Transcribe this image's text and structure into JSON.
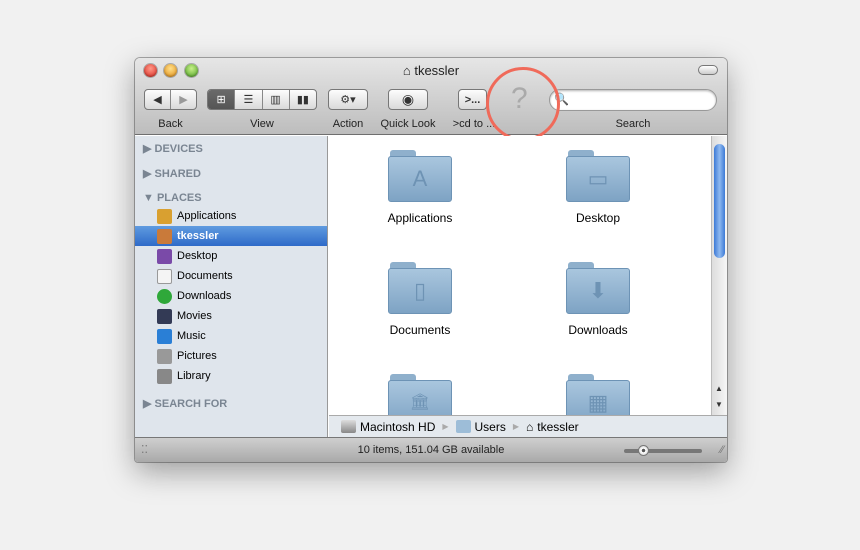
{
  "window": {
    "title": "tkessler"
  },
  "toolbar": {
    "back": "Back",
    "view": "View",
    "action": "Action",
    "quick_look": "Quick Look",
    "cd_to": ">cd to ...",
    "cd_glyph": ">...",
    "search": "Search",
    "search_placeholder": "",
    "unknown_glyph": "?"
  },
  "sidebar": {
    "devices": "DEVICES",
    "shared": "SHARED",
    "places": "PLACES",
    "search_for": "SEARCH FOR",
    "items": [
      {
        "label": "Applications",
        "color": "#d9a030"
      },
      {
        "label": "tkessler",
        "color": "#c97a3a"
      },
      {
        "label": "Desktop",
        "color": "#7a4aa8"
      },
      {
        "label": "Documents",
        "color": "#f4f4f4"
      },
      {
        "label": "Downloads",
        "color": "#2fa83a"
      },
      {
        "label": "Movies",
        "color": "#333a55"
      },
      {
        "label": "Music",
        "color": "#2a7fd6"
      },
      {
        "label": "Pictures",
        "color": "#999"
      },
      {
        "label": "Library",
        "color": "#888"
      }
    ]
  },
  "content": {
    "items": [
      {
        "label": "Applications",
        "icon": "A"
      },
      {
        "label": "Desktop",
        "icon": "▭"
      },
      {
        "label": "Documents",
        "icon": "▯"
      },
      {
        "label": "Downloads",
        "icon": "⬇"
      },
      {
        "label": "",
        "icon": "🏛"
      },
      {
        "label": "",
        "icon": "▦"
      }
    ]
  },
  "pathbar": [
    "Macintosh HD",
    "Users",
    "tkessler"
  ],
  "status": {
    "text": "10 items, 151.04 GB available"
  },
  "colors": {
    "selection": "#3a76d0",
    "annotation_circle": "#f06a5a"
  }
}
